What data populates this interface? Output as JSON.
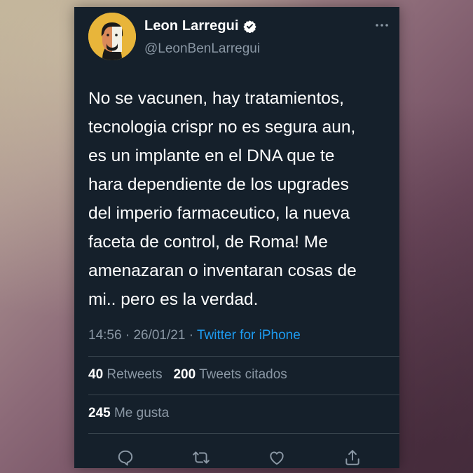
{
  "author": {
    "display_name": "Leon Larregui",
    "handle": "@LeonBenLarregui",
    "verified": true,
    "avatar_icon": "avatar"
  },
  "tweet": {
    "lines": [
      "No se vacunen, hay tratamientos,",
      "tecnologia crispr no es segura aun,",
      "es un implante en el DNA que te",
      "hara dependiente de los upgrades",
      "del imperio farmaceutico, la nueva",
      "faceta de control, de Roma! Me",
      "amenazaran o inventaran cosas de",
      "mi.. pero es la verdad."
    ],
    "time": "14:56",
    "date": "26/01/21",
    "separator": "·",
    "source": "Twitter for iPhone"
  },
  "stats": {
    "retweets_count": "40",
    "retweets_label": "Retweets",
    "quotes_count": "200",
    "quotes_label": "Tweets citados",
    "likes_count": "245",
    "likes_label": "Me gusta"
  },
  "actions": [
    "reply-icon",
    "retweet-icon",
    "like-icon",
    "share-icon"
  ],
  "colors": {
    "card_background": "#15202b",
    "text_primary": "#ffffff",
    "text_secondary": "#8b98a5",
    "link": "#1d9bf0",
    "divider": "#38444d"
  }
}
